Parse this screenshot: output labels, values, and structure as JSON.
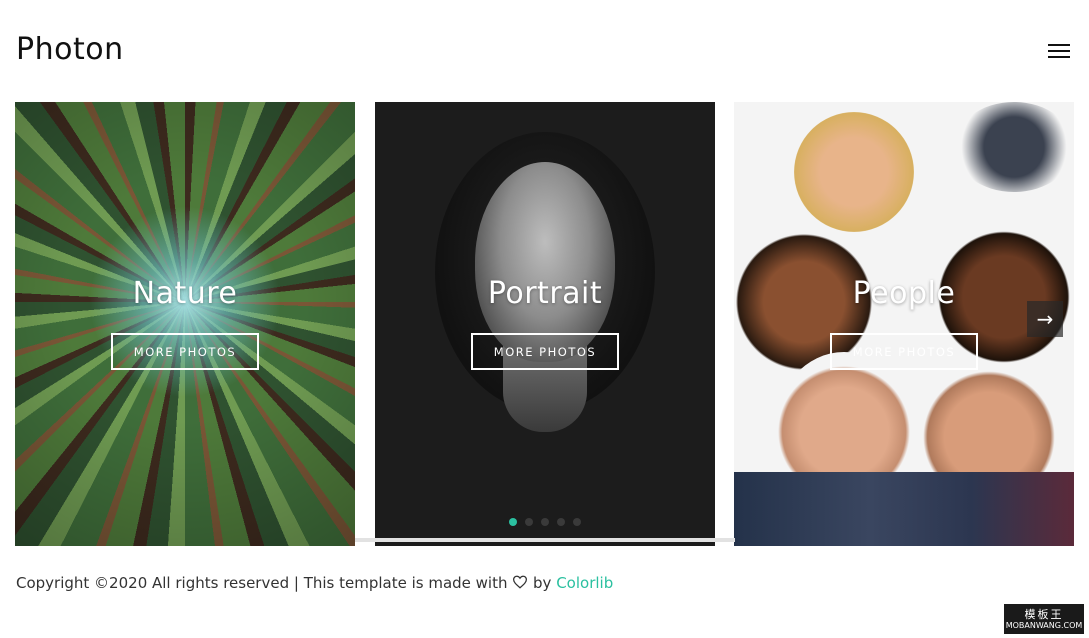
{
  "header": {
    "brand": "Photon"
  },
  "cards": [
    {
      "title": "Nature",
      "button": "MORE PHOTOS"
    },
    {
      "title": "Portrait",
      "button": "MORE PHOTOS"
    },
    {
      "title": "People",
      "button": "MORE PHOTOS"
    }
  ],
  "slider": {
    "dot_count": 5,
    "active_dot": 1
  },
  "footer": {
    "text_before": "Copyright ©2020 All rights reserved | This template is made with ",
    "text_by": " by ",
    "link": "Colorlib"
  },
  "watermark": {
    "title": "模板王",
    "url": "MOBANWANG.COM"
  },
  "colors": {
    "accent": "#2bc0a0"
  },
  "icons": {
    "menu": "hamburger-icon",
    "next": "arrow-right-icon",
    "heart": "heart-icon"
  }
}
